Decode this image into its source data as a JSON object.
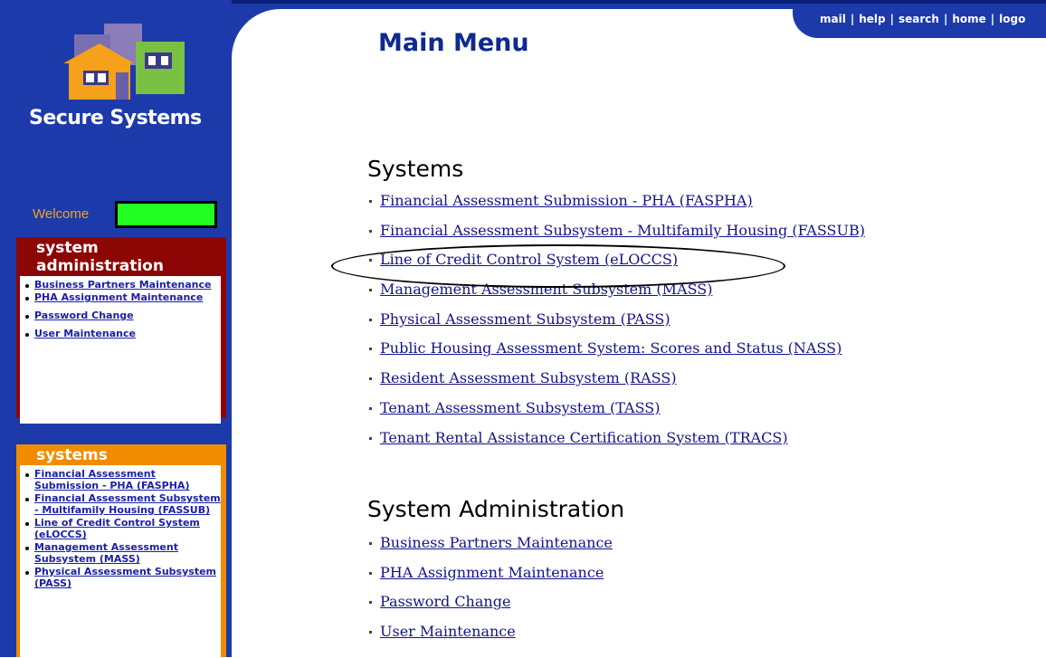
{
  "header": {
    "title": "Main Menu",
    "links": [
      "mail",
      "help",
      "search",
      "home",
      "logo"
    ]
  },
  "logo": {
    "text": "Secure Systems"
  },
  "welcome": {
    "label": "Welcome"
  },
  "sidebar": {
    "admin": {
      "title_line1": "system",
      "title_line2": "administration",
      "items": [
        "Business Partners Maintenance",
        "PHA Assignment Maintenance",
        "Password Change",
        "User Maintenance"
      ]
    },
    "systems": {
      "title": "systems",
      "items": [
        "Financial Assessment Submission - PHA (FASPHA)",
        "Financial Assessment Subsystem - Multifamily Housing (FASSUB)",
        "Line of Credit Control System (eLOCCS)",
        "Management Assessment Subsystem (MASS)",
        "Physical Assessment Subsystem (PASS)"
      ]
    }
  },
  "main": {
    "systems_title": "Systems",
    "systems": [
      "Financial Assessment Submission - PHA (FASPHA)",
      "Financial Assessment Subsystem - Multifamily Housing (FASSUB)",
      "Line of Credit Control System (eLOCCS)",
      "Management Assessment Subsystem (MASS)",
      "Physical Assessment Subsystem (PASS)",
      "Public Housing Assessment System: Scores and Status (NASS)",
      "Resident Assessment Subsystem (RASS)",
      "Tenant Assessment Subsystem (TASS)",
      "Tenant Rental Assistance Certification System (TRACS)"
    ],
    "admin_title": "System Administration",
    "admin": [
      "Business Partners Maintenance",
      "PHA Assignment Maintenance",
      "Password Change",
      "User Maintenance"
    ]
  },
  "colors": {
    "primary_blue": "#1c3aa9",
    "admin_red": "#8d0606",
    "systems_orange": "#f08c00",
    "welcome_green": "#22ff22",
    "welcome_text": "#f6a11b"
  }
}
